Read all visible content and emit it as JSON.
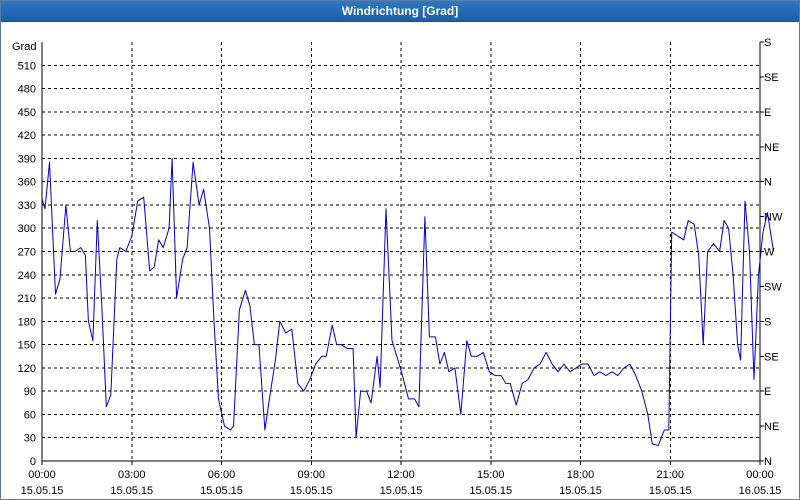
{
  "window": {
    "title": "Windrichtung [Grad]"
  },
  "chart_data": {
    "type": "line",
    "title": "Windrichtung [Grad]",
    "ylabel": "Grad",
    "ylim": [
      0,
      540
    ],
    "xlim_hours": [
      0,
      24
    ],
    "y_ticks": [
      0,
      30,
      60,
      90,
      120,
      150,
      180,
      210,
      240,
      270,
      300,
      330,
      360,
      390,
      420,
      450,
      480,
      510
    ],
    "y2_ticks": [
      {
        "value": 0,
        "label": "N"
      },
      {
        "value": 45,
        "label": "NE"
      },
      {
        "value": 90,
        "label": "E"
      },
      {
        "value": 135,
        "label": "SE"
      },
      {
        "value": 180,
        "label": "S"
      },
      {
        "value": 225,
        "label": "SW"
      },
      {
        "value": 270,
        "label": "W"
      },
      {
        "value": 315,
        "label": "NW"
      },
      {
        "value": 360,
        "label": "N"
      },
      {
        "value": 405,
        "label": "NE"
      },
      {
        "value": 450,
        "label": "E"
      },
      {
        "value": 495,
        "label": "SE"
      },
      {
        "value": 540,
        "label": "S"
      }
    ],
    "x_ticks": [
      {
        "time": "00:00",
        "date": "15.05.15"
      },
      {
        "time": "03:00",
        "date": "15.05.15"
      },
      {
        "time": "06:00",
        "date": "15.05.15"
      },
      {
        "time": "09:00",
        "date": "15.05.15"
      },
      {
        "time": "12:00",
        "date": "15.05.15"
      },
      {
        "time": "15:00",
        "date": "15.05.15"
      },
      {
        "time": "18:00",
        "date": "15.05.15"
      },
      {
        "time": "21:00",
        "date": "15.05.15"
      },
      {
        "time": "00:00",
        "date": "16.05.15"
      }
    ],
    "grid": true,
    "line_color": "#0000c8",
    "series": [
      {
        "points": [
          [
            0.0,
            338
          ],
          [
            0.1,
            325
          ],
          [
            0.25,
            385
          ],
          [
            0.45,
            215
          ],
          [
            0.6,
            235
          ],
          [
            0.8,
            330
          ],
          [
            0.95,
            270
          ],
          [
            1.1,
            270
          ],
          [
            1.3,
            275
          ],
          [
            1.45,
            265
          ],
          [
            1.55,
            180
          ],
          [
            1.7,
            155
          ],
          [
            1.85,
            310
          ],
          [
            2.0,
            200
          ],
          [
            2.15,
            70
          ],
          [
            2.3,
            85
          ],
          [
            2.5,
            260
          ],
          [
            2.6,
            275
          ],
          [
            2.8,
            270
          ],
          [
            3.0,
            290
          ],
          [
            3.2,
            335
          ],
          [
            3.4,
            340
          ],
          [
            3.6,
            245
          ],
          [
            3.75,
            250
          ],
          [
            3.9,
            285
          ],
          [
            4.05,
            275
          ],
          [
            4.25,
            300
          ],
          [
            4.35,
            390
          ],
          [
            4.5,
            210
          ],
          [
            4.7,
            260
          ],
          [
            4.85,
            275
          ],
          [
            5.05,
            385
          ],
          [
            5.25,
            330
          ],
          [
            5.4,
            350
          ],
          [
            5.6,
            300
          ],
          [
            5.75,
            180
          ],
          [
            5.9,
            80
          ],
          [
            6.1,
            45
          ],
          [
            6.3,
            40
          ],
          [
            6.4,
            45
          ],
          [
            6.6,
            195
          ],
          [
            6.8,
            220
          ],
          [
            6.95,
            200
          ],
          [
            7.1,
            150
          ],
          [
            7.25,
            150
          ],
          [
            7.45,
            40
          ],
          [
            7.6,
            80
          ],
          [
            7.8,
            130
          ],
          [
            7.95,
            180
          ],
          [
            8.15,
            165
          ],
          [
            8.35,
            170
          ],
          [
            8.55,
            100
          ],
          [
            8.75,
            90
          ],
          [
            8.95,
            105
          ],
          [
            9.15,
            125
          ],
          [
            9.35,
            135
          ],
          [
            9.5,
            135
          ],
          [
            9.7,
            175
          ],
          [
            9.85,
            150
          ],
          [
            10.0,
            150
          ],
          [
            10.2,
            145
          ],
          [
            10.4,
            145
          ],
          [
            10.5,
            30
          ],
          [
            10.65,
            90
          ],
          [
            10.85,
            90
          ],
          [
            11.0,
            75
          ],
          [
            11.2,
            135
          ],
          [
            11.3,
            95
          ],
          [
            11.5,
            325
          ],
          [
            11.7,
            155
          ],
          [
            11.9,
            130
          ],
          [
            12.05,
            110
          ],
          [
            12.25,
            80
          ],
          [
            12.45,
            80
          ],
          [
            12.6,
            70
          ],
          [
            12.8,
            315
          ],
          [
            12.95,
            160
          ],
          [
            13.15,
            160
          ],
          [
            13.3,
            125
          ],
          [
            13.45,
            140
          ],
          [
            13.6,
            115
          ],
          [
            13.8,
            120
          ],
          [
            14.0,
            60
          ],
          [
            14.2,
            155
          ],
          [
            14.35,
            135
          ],
          [
            14.55,
            135
          ],
          [
            14.75,
            140
          ],
          [
            14.95,
            115
          ],
          [
            15.15,
            110
          ],
          [
            15.35,
            110
          ],
          [
            15.5,
            100
          ],
          [
            15.65,
            100
          ],
          [
            15.85,
            72
          ],
          [
            16.05,
            100
          ],
          [
            16.25,
            105
          ],
          [
            16.45,
            120
          ],
          [
            16.65,
            125
          ],
          [
            16.85,
            140
          ],
          [
            17.05,
            125
          ],
          [
            17.25,
            115
          ],
          [
            17.45,
            125
          ],
          [
            17.65,
            115
          ],
          [
            17.85,
            120
          ],
          [
            18.05,
            125
          ],
          [
            18.25,
            125
          ],
          [
            18.45,
            110
          ],
          [
            18.65,
            115
          ],
          [
            18.85,
            110
          ],
          [
            19.05,
            115
          ],
          [
            19.25,
            110
          ],
          [
            19.45,
            120
          ],
          [
            19.65,
            125
          ],
          [
            19.85,
            110
          ],
          [
            20.05,
            90
          ],
          [
            20.25,
            60
          ],
          [
            20.4,
            22
          ],
          [
            20.6,
            20
          ],
          [
            20.8,
            40
          ],
          [
            20.95,
            40
          ],
          [
            21.05,
            295
          ],
          [
            21.25,
            290
          ],
          [
            21.45,
            285
          ],
          [
            21.6,
            310
          ],
          [
            21.8,
            305
          ],
          [
            21.95,
            265
          ],
          [
            22.1,
            150
          ],
          [
            22.25,
            270
          ],
          [
            22.45,
            280
          ],
          [
            22.65,
            270
          ],
          [
            22.8,
            310
          ],
          [
            22.95,
            300
          ],
          [
            23.1,
            240
          ],
          [
            23.25,
            150
          ],
          [
            23.35,
            130
          ],
          [
            23.5,
            335
          ],
          [
            23.65,
            270
          ],
          [
            23.8,
            105
          ],
          [
            23.95,
            240
          ],
          [
            24.1,
            295
          ],
          [
            24.25,
            320
          ],
          [
            24.45,
            270
          ]
        ]
      }
    ]
  }
}
